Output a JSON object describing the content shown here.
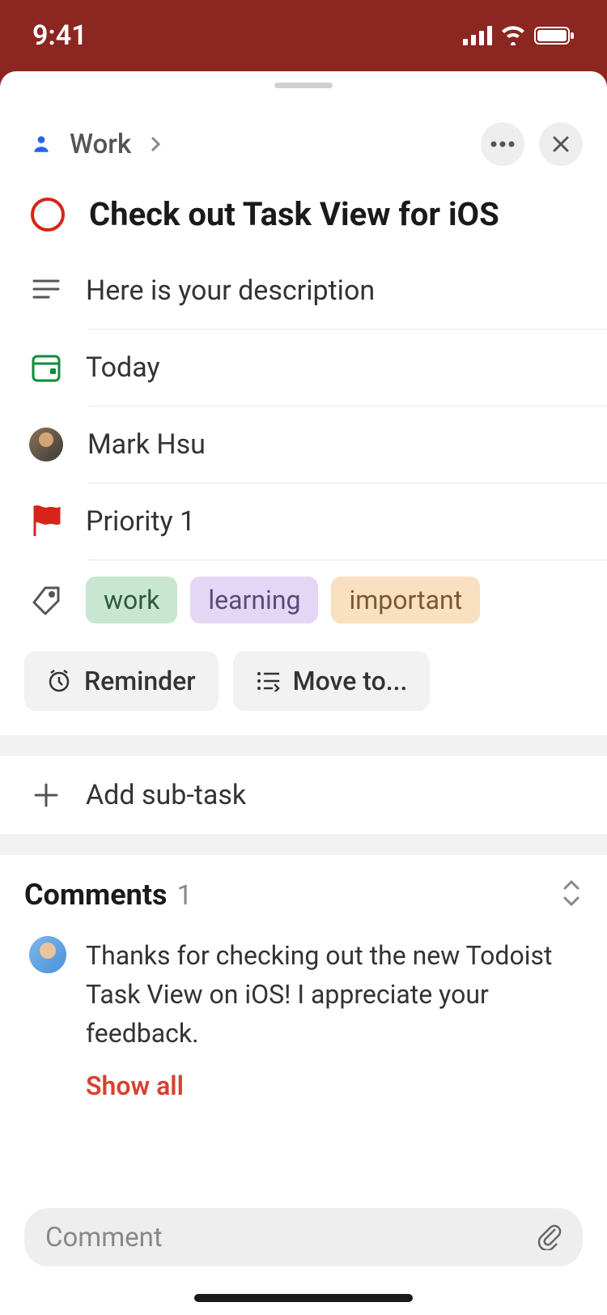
{
  "status": {
    "time": "9:41"
  },
  "header": {
    "breadcrumb": "Work"
  },
  "task": {
    "title": "Check out Task View for iOS",
    "description": "Here is your description",
    "date": "Today",
    "assignee": "Mark Hsu",
    "priority": "Priority 1",
    "tags": [
      "work",
      "learning",
      "important"
    ]
  },
  "actions": {
    "reminder": "Reminder",
    "move": "Move to..."
  },
  "subtask": {
    "add": "Add sub-task"
  },
  "comments": {
    "title": "Comments",
    "count": "1",
    "body": "Thanks for checking out the new Todoist Task View on iOS! I appreciate your feedback.",
    "show_all": "Show all",
    "placeholder": "Comment"
  }
}
